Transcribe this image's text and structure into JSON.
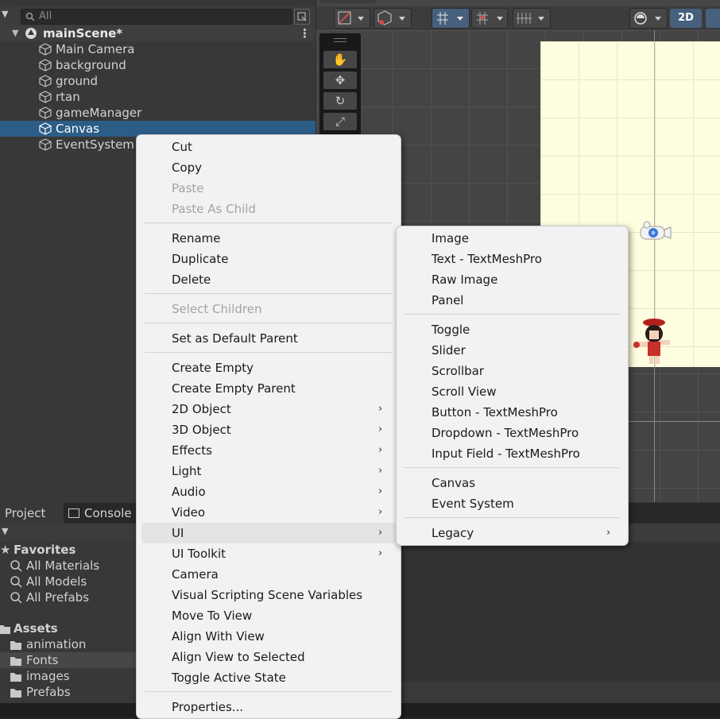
{
  "hierarchy": {
    "search_placeholder": "All",
    "scene_name": "mainScene*",
    "objects": [
      "Main Camera",
      "background",
      "ground",
      "rtan",
      "gameManager",
      "Canvas",
      "EventSystem"
    ],
    "selected": "Canvas"
  },
  "scene_toolbar": {
    "mode_2d_label": "2D"
  },
  "project": {
    "tabs": [
      "Project",
      "Console"
    ],
    "favorites_label": "Favorites",
    "favorites": [
      "All Materials",
      "All Models",
      "All Prefabs"
    ],
    "assets_label": "Assets",
    "folders": [
      "animation",
      "Fonts",
      "images",
      "Prefabs"
    ],
    "highlighted_folder": "Fonts"
  },
  "context_menu": {
    "items": [
      {
        "label": "Cut"
      },
      {
        "label": "Copy"
      },
      {
        "label": "Paste",
        "disabled": true
      },
      {
        "label": "Paste As Child",
        "disabled": true
      },
      {
        "label": "Rename"
      },
      {
        "label": "Duplicate"
      },
      {
        "label": "Delete"
      },
      {
        "label": "Select Children",
        "disabled": true
      },
      {
        "label": "Set as Default Parent"
      },
      {
        "label": "Create Empty"
      },
      {
        "label": "Create Empty Parent"
      },
      {
        "label": "2D Object",
        "submenu": true
      },
      {
        "label": "3D Object",
        "submenu": true
      },
      {
        "label": "Effects",
        "submenu": true
      },
      {
        "label": "Light",
        "submenu": true
      },
      {
        "label": "Audio",
        "submenu": true
      },
      {
        "label": "Video",
        "submenu": true
      },
      {
        "label": "UI",
        "submenu": true,
        "highlighted": true
      },
      {
        "label": "UI Toolkit",
        "submenu": true
      },
      {
        "label": "Camera"
      },
      {
        "label": "Visual Scripting Scene Variables"
      },
      {
        "label": "Move To View"
      },
      {
        "label": "Align With View"
      },
      {
        "label": "Align View to Selected"
      },
      {
        "label": "Toggle Active State"
      },
      {
        "label": "Properties..."
      }
    ]
  },
  "ui_submenu": {
    "items": [
      {
        "label": "Image"
      },
      {
        "label": "Text - TextMeshPro"
      },
      {
        "label": "Raw Image"
      },
      {
        "label": "Panel"
      },
      {
        "label": "Toggle"
      },
      {
        "label": "Slider"
      },
      {
        "label": "Scrollbar"
      },
      {
        "label": "Scroll View"
      },
      {
        "label": "Button - TextMeshPro"
      },
      {
        "label": "Dropdown - TextMeshPro"
      },
      {
        "label": "Input Field - TextMeshPro"
      },
      {
        "label": "Canvas"
      },
      {
        "label": "Event System"
      },
      {
        "label": "Legacy",
        "submenu": true
      }
    ]
  },
  "icons": {
    "submenu_arrow": "›",
    "foldout_open": "▼",
    "kebab": "⋮",
    "star": "★"
  },
  "colors": {
    "selection": "#2c5d87",
    "menu_bg": "#f2f2f2",
    "canvas_bg": "#fffde0"
  }
}
